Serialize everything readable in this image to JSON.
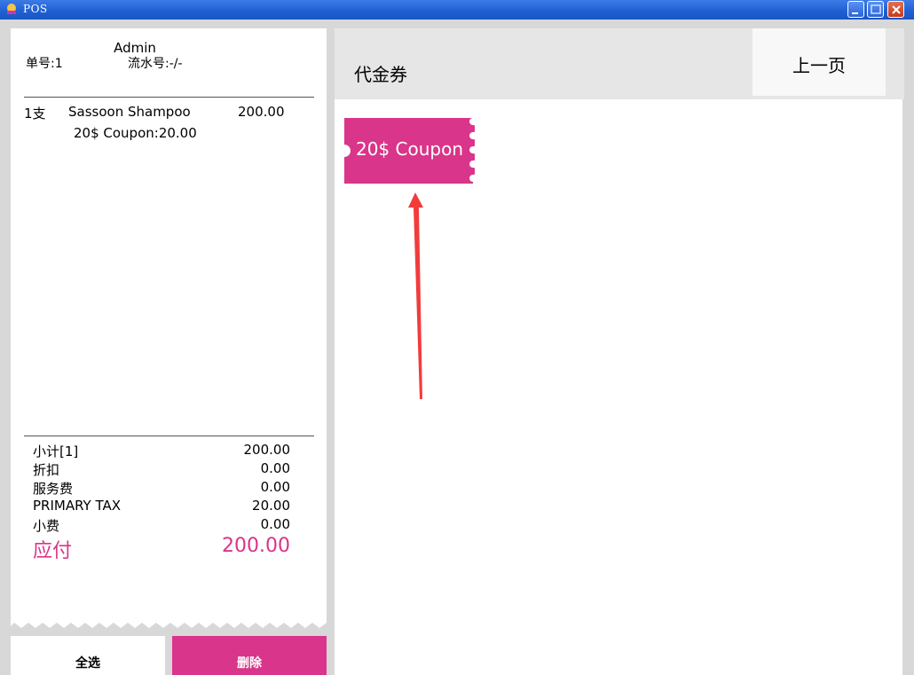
{
  "window": {
    "title": "POS"
  },
  "receipt": {
    "user": "Admin",
    "order_no": "单号:1",
    "serial_no": "流水号:-/-",
    "line_items": [
      {
        "qty": "1支",
        "name": "Sassoon Shampoo",
        "price": "200.00",
        "sub": "20$ Coupon:20.00"
      }
    ],
    "totals": [
      {
        "label": "小计[1]",
        "value": "200.00"
      },
      {
        "label": "折扣",
        "value": "0.00"
      },
      {
        "label": "服务费",
        "value": "0.00"
      },
      {
        "label": "PRIMARY TAX",
        "value": "20.00"
      },
      {
        "label": "小费",
        "value": "0.00"
      }
    ],
    "amount_due": {
      "label": "应付",
      "value": "200.00"
    }
  },
  "actions": {
    "select_all": "全选",
    "delete": "删除"
  },
  "category": {
    "title": "代金券",
    "prev_page": "上一页"
  },
  "coupons": [
    {
      "label": "20$ Coupon"
    }
  ],
  "colors": {
    "accent": "#d9358a",
    "titlebar": "#2a66d8",
    "annotation": "#f23c3c"
  }
}
